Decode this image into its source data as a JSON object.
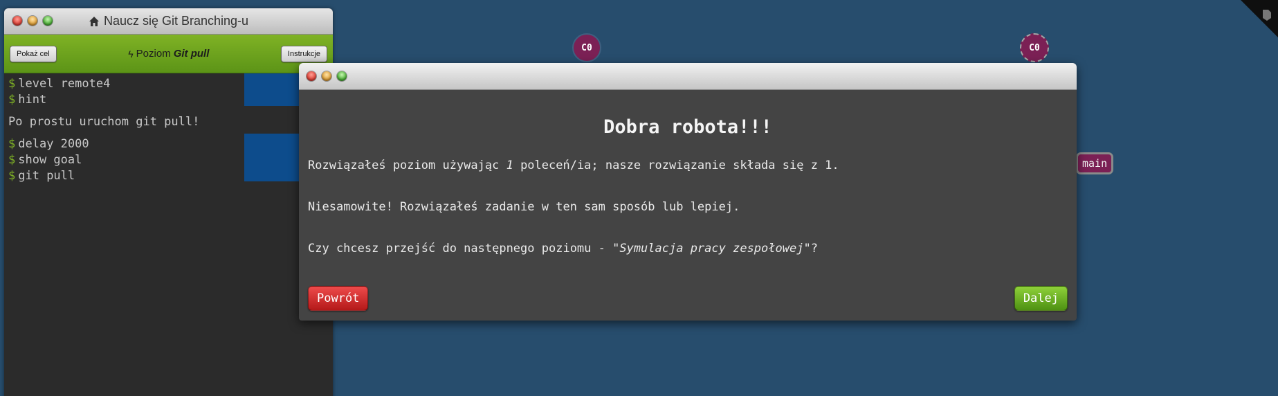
{
  "terminal": {
    "window_title": "Naucz się Git Branching-u",
    "show_goal_label": "Pokaż cel",
    "instructions_label": "Instrukcje",
    "level_prefix": "Poziom",
    "level_name": "Git pull",
    "prompt_symbol": "$",
    "history_block1": [
      "level remote4",
      "hint"
    ],
    "hint_output": "Po prostu uruchom git pull!",
    "history_block2": [
      "delay 2000",
      "show goal",
      "git pull"
    ]
  },
  "visualization": {
    "commit_left": "C0",
    "commit_right": "C0",
    "branch_label": "main",
    "commit_color": "#7b2055"
  },
  "modal": {
    "heading": "Dobra robota!!!",
    "line1_before": "Rozwiązałeś poziom używając ",
    "line1_count": "1",
    "line1_after": " poleceń/ia; nasze rozwiązanie składa się z 1.",
    "line2": "Niesamowite! Rozwiązałeś zadanie w ten sam sposób lub lepiej.",
    "line3_before": "Czy chcesz przejść do następnego poziomu - ",
    "line3_level": "\"Symulacja pracy zespołowej\"",
    "line3_after": "?",
    "back_label": "Powrót",
    "next_label": "Dalej"
  }
}
